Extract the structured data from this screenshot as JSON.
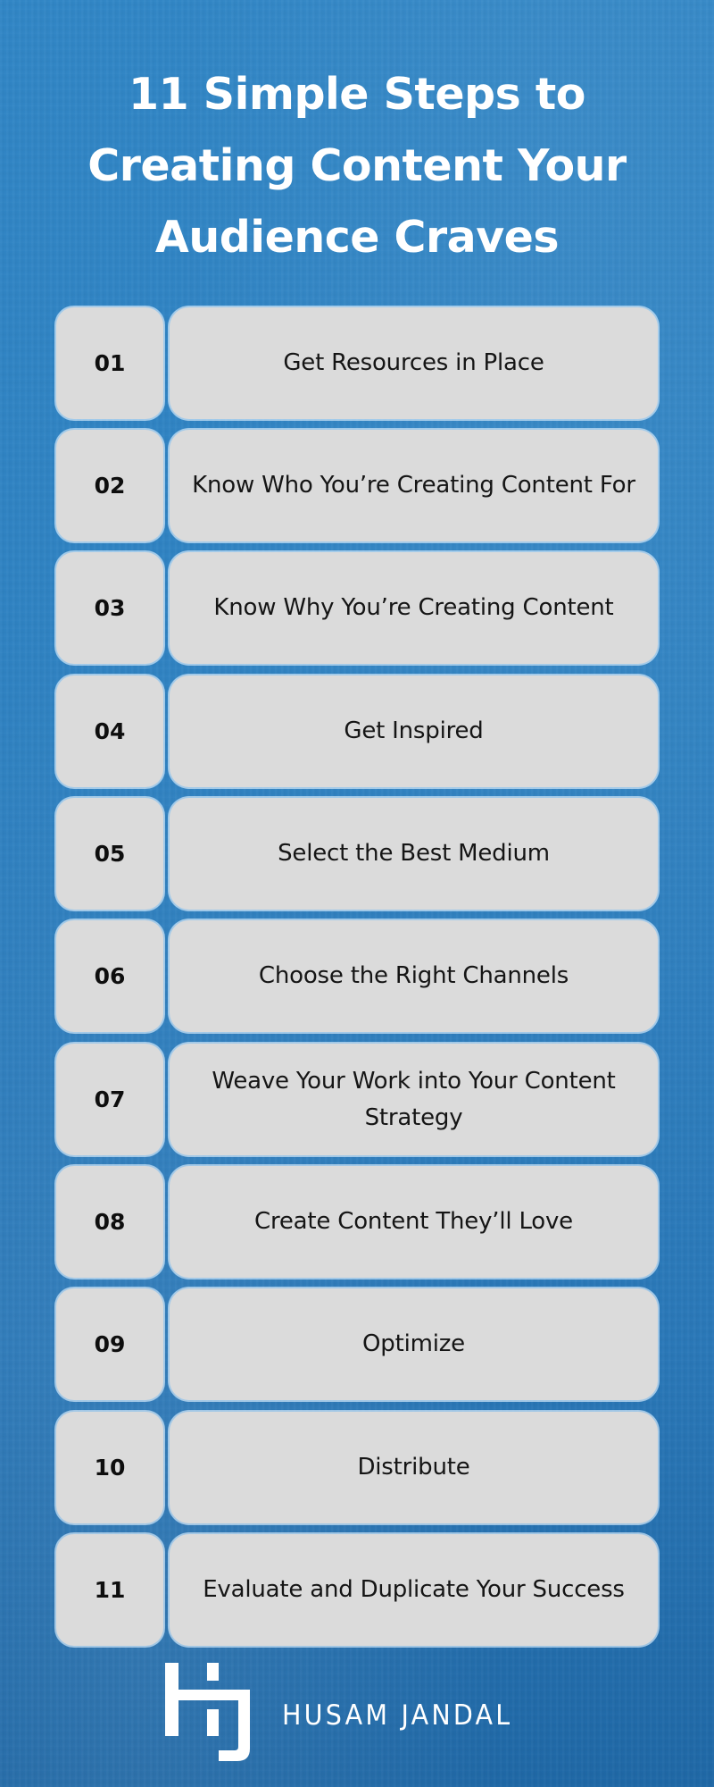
{
  "title": {
    "lines": [
      "11 Simple Steps to",
      "Creating Content Your",
      "Audience Craves"
    ]
  },
  "steps": [
    {
      "number": "01",
      "label": "Get Resources in Place"
    },
    {
      "number": "02",
      "label": "Know Who You’re Creating Content For"
    },
    {
      "number": "03",
      "label": "Know Why You’re Creating Content"
    },
    {
      "number": "04",
      "label": "Get Inspired"
    },
    {
      "number": "05",
      "label": "Select the Best Medium"
    },
    {
      "number": "06",
      "label": "Choose the Right Channels"
    },
    {
      "number": "07",
      "label": "Weave Your Work into Your Content Strategy"
    },
    {
      "number": "08",
      "label": "Create Content They’ll Love"
    },
    {
      "number": "09",
      "label": "Optimize"
    },
    {
      "number": "10",
      "label": "Distribute"
    },
    {
      "number": "11",
      "label": "Evaluate and Duplicate Your Success"
    }
  ],
  "footer": {
    "logo_icon": "hj-monogram-logo",
    "brand_name": "HUSAM JANDAL"
  },
  "colors": {
    "background": "#2f82c2",
    "box": "#dbdbdb",
    "text_dark": "#151515",
    "text_light": "#ffffff"
  }
}
